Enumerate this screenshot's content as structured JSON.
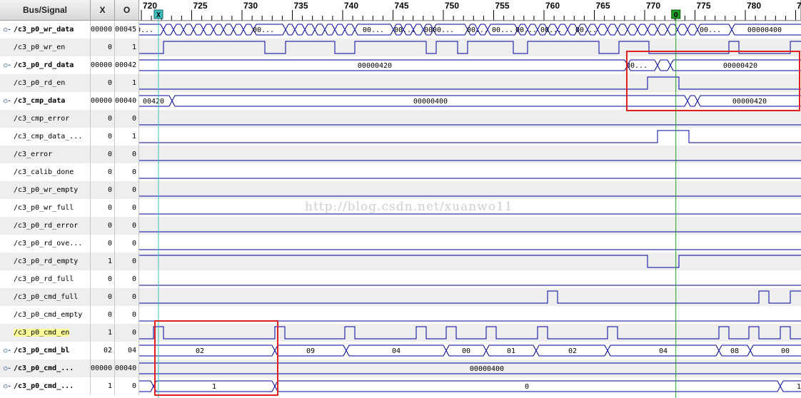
{
  "columns": {
    "signal": "Bus/Signal",
    "x": "X",
    "o": "O"
  },
  "ticks": [
    "720",
    "725",
    "730",
    "735",
    "740",
    "745",
    "750",
    "755",
    "760",
    "765",
    "770",
    "775",
    "780",
    "7"
  ],
  "cursors": {
    "x": {
      "label": "X",
      "color": "#40c0c0"
    },
    "o": {
      "label": "O",
      "color": "#20a020"
    }
  },
  "colors": {
    "wave": "#0000a0",
    "highlight_box": "#e02020",
    "name_highlight": "#ffff99"
  },
  "watermark": "http://blog.csdn.net/xuanwo11",
  "rows": [
    {
      "name": "/c3_p0_wr_data",
      "bus": true,
      "x": "00000",
      "o": "00045",
      "labels": [
        "0...",
        "00...",
        "00...",
        "00...",
        "0000...",
        "00...",
        "00...",
        "00...",
        "00...",
        "00...",
        "00...",
        "00000400"
      ]
    },
    {
      "name": "/c3_p0_wr_en",
      "bus": false,
      "x": "0",
      "o": "1"
    },
    {
      "name": "/c3_p0_rd_data",
      "bus": true,
      "x": "00000",
      "o": "00042",
      "labels": [
        "00000420",
        "00...",
        "00000420"
      ]
    },
    {
      "name": "/c3_p0_rd_en",
      "bus": false,
      "x": "0",
      "o": "1"
    },
    {
      "name": "/c3_cmp_data",
      "bus": true,
      "x": "00000",
      "o": "00040",
      "labels": [
        "00420",
        "00000400",
        "00000420"
      ]
    },
    {
      "name": "/c3_cmp_error",
      "bus": false,
      "x": "0",
      "o": "0"
    },
    {
      "name": "/c3_cmp_data_...",
      "bus": false,
      "x": "0",
      "o": "1"
    },
    {
      "name": "/c3_error",
      "bus": false,
      "x": "0",
      "o": "0"
    },
    {
      "name": "/c3_calib_done",
      "bus": false,
      "x": "0",
      "o": "0"
    },
    {
      "name": "/c3_p0_wr_empty",
      "bus": false,
      "x": "0",
      "o": "0"
    },
    {
      "name": "/c3_p0_wr_full",
      "bus": false,
      "x": "0",
      "o": "0"
    },
    {
      "name": "/c3_p0_rd_error",
      "bus": false,
      "x": "0",
      "o": "0"
    },
    {
      "name": "/c3_p0_rd_ove...",
      "bus": false,
      "x": "0",
      "o": "0"
    },
    {
      "name": "/c3_p0_rd_empty",
      "bus": false,
      "x": "1",
      "o": "0"
    },
    {
      "name": "/c3_p0_rd_full",
      "bus": false,
      "x": "0",
      "o": "0"
    },
    {
      "name": "/c3_p0_cmd_full",
      "bus": false,
      "x": "0",
      "o": "0"
    },
    {
      "name": "/c3_p0_cmd_empty",
      "bus": false,
      "x": "0",
      "o": "0"
    },
    {
      "name": "/c3_p0_cmd_en",
      "bus": false,
      "x": "1",
      "o": "0",
      "highlight": true
    },
    {
      "name": "/c3_p0_cmd_bl",
      "bus": true,
      "x": "02",
      "o": "04",
      "labels": [
        "02",
        "09",
        "04",
        "00",
        "01",
        "02",
        "04",
        "08",
        "00"
      ]
    },
    {
      "name": "/c3_p0_cmd_...",
      "bus": true,
      "x": "00000",
      "o": "00040",
      "labels": [
        "00000400"
      ]
    },
    {
      "name": "/c3_p0_cmd_...",
      "bus": true,
      "x": "1",
      "o": "0",
      "labels": [
        "1",
        "0",
        "1"
      ]
    }
  ]
}
